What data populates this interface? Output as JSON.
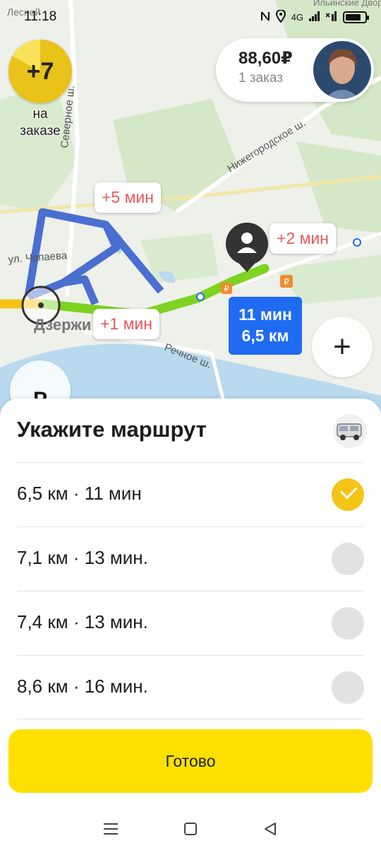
{
  "status_bar": {
    "time": "11:18",
    "network": "4G",
    "battery_level": 0.8
  },
  "map": {
    "bonus": {
      "value": "+7",
      "caption_line1": "на",
      "caption_line2": "заказе"
    },
    "earnings": {
      "amount": "88,60₽",
      "orders": "1 заказ"
    },
    "labels": {
      "street1": "Северное ш.",
      "street2": "Нижегородское ш.",
      "street3": "ул. Чапаева",
      "street4": "Речное ш.",
      "city": "Дзержи",
      "top_left": "Лесной",
      "top_right": "Ильинские Дворики"
    },
    "callouts": {
      "c1": "+5 мин",
      "c2": "+2 мин",
      "c3": "+1 мин"
    },
    "eta": {
      "time": "11 мин",
      "distance": "6,5 км"
    },
    "parking_label": "P",
    "zoom_in": "+",
    "colors": {
      "route_selected": "#7ed321",
      "route_alt": "#4a6fd1",
      "eta_bg": "#1f6bf2"
    }
  },
  "sheet": {
    "title": "Укажите маршрут",
    "routes": [
      {
        "label": "6,5 км · 11 мин",
        "selected": true
      },
      {
        "label": "7,1 км · 13 мин.",
        "selected": false
      },
      {
        "label": "7,4 км · 13 мин.",
        "selected": false
      },
      {
        "label": "8,6 км · 16 мин.",
        "selected": false
      }
    ],
    "done_button": "Готово",
    "accent": "#fde000"
  },
  "nav_bar": {
    "icons": [
      "menu-icon",
      "home-square-icon",
      "back-triangle-icon"
    ]
  }
}
